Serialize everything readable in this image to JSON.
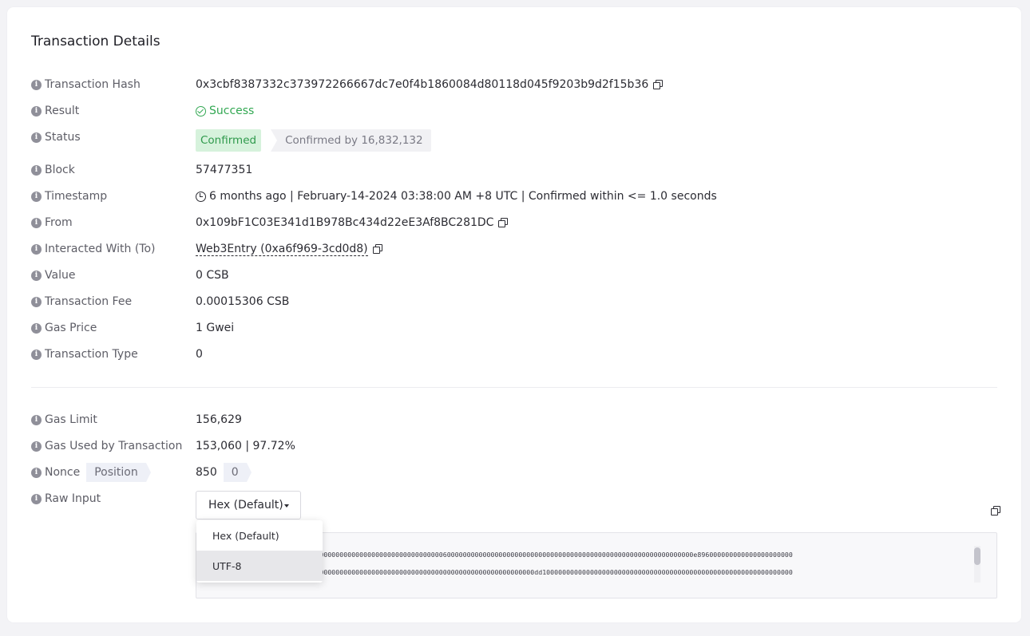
{
  "title": "Transaction Details",
  "rows": {
    "tx_hash": {
      "label": "Transaction Hash",
      "value": "0x3cbf8387332c373972266667dc7e0f4b1860084d80118d045f9203b9d2f15b36"
    },
    "result": {
      "label": "Result",
      "value": "Success"
    },
    "status": {
      "label": "Status",
      "badge": "Confirmed",
      "confirmations": "Confirmed by 16,832,132"
    },
    "block": {
      "label": "Block",
      "value": "57477351"
    },
    "timestamp": {
      "label": "Timestamp",
      "value": "6 months ago | February-14-2024 03:38:00 AM +8 UTC | Confirmed within <= 1.0 seconds"
    },
    "from": {
      "label": "From",
      "value": "0x109bF1C03E341d1B978Bc434d22eE3Af8BC281DC"
    },
    "to": {
      "label": "Interacted With (To)",
      "value": "Web3Entry (0xa6f969-3cd0d8)"
    },
    "value": {
      "label": "Value",
      "value": "0 CSB"
    },
    "fee": {
      "label": "Transaction Fee",
      "value": "0.00015306 CSB"
    },
    "gas_price": {
      "label": "Gas Price",
      "value": "1 Gwei"
    },
    "tx_type": {
      "label": "Transaction Type",
      "value": "0"
    },
    "gas_limit": {
      "label": "Gas Limit",
      "value": "156,629"
    },
    "gas_used": {
      "label": "Gas Used by Transaction",
      "value": "153,060 | 97.72%"
    },
    "nonce": {
      "label": "Nonce",
      "position_label": "Position",
      "value": "850",
      "position": "0"
    },
    "raw_input": {
      "label": "Raw Input",
      "selected": "Hex (Default)"
    }
  },
  "dropdown_options": [
    "Hex (Default)",
    "UTF-8"
  ],
  "raw_lines": [
    "00000000000000000000000000000000000000000000000000000000000000600000000000000000000000000000000000000000000000000000000000000e896000000000000000000000",
    "0000000000000000000000035000000000000000000000000000000000000000000000000000000000000dd100000000000000000000000000000000000000000000000000000000000000"
  ],
  "colors": {
    "success": "#33a853",
    "badge_bg": "#d6f2dc"
  }
}
